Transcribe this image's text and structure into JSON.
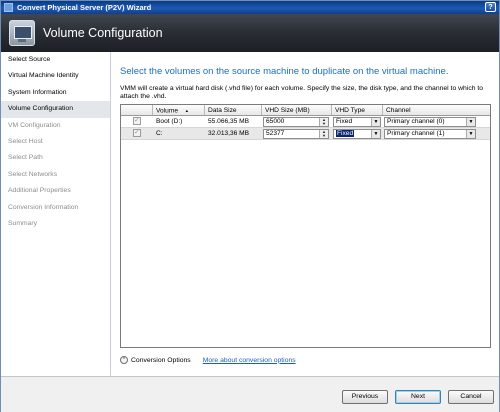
{
  "window": {
    "title": "Convert Physical Server (P2V) Wizard",
    "help_label": "?"
  },
  "banner": {
    "title": "Volume Configuration"
  },
  "nav": {
    "items": [
      {
        "label": "Select Source",
        "state": "done"
      },
      {
        "label": "Virtual Machine Identity",
        "state": "done"
      },
      {
        "label": "System Information",
        "state": "done"
      },
      {
        "label": "Volume Configuration",
        "state": "selected"
      },
      {
        "label": "VM Configuration",
        "state": "dim"
      },
      {
        "label": "Select Host",
        "state": "dim"
      },
      {
        "label": "Select Path",
        "state": "dim"
      },
      {
        "label": "Select Networks",
        "state": "dim"
      },
      {
        "label": "Additional Properties",
        "state": "dim"
      },
      {
        "label": "Conversion Information",
        "state": "dim"
      },
      {
        "label": "Summary",
        "state": "dim"
      }
    ]
  },
  "main": {
    "heading": "Select the volumes on the source machine to duplicate on the virtual machine.",
    "description": "VMM will create a virtual hard disk (.vhd file) for each volume. Specify the size, the disk type, and the channel to which to attach the .vhd."
  },
  "grid": {
    "columns": [
      "",
      "Volume",
      "Data Size",
      "VHD Size (MB)",
      "VHD Type",
      "Channel"
    ],
    "sort_indicator": "▲",
    "rows": [
      {
        "checked": true,
        "volume": "Boot (D:)",
        "data_size": "55.066,35 MB",
        "vhd_size": "65000",
        "vhd_type": "Fixed",
        "channel": "Primary channel (0)"
      },
      {
        "checked": true,
        "volume": "C:",
        "data_size": "32.013,36 MB",
        "vhd_size": "52377",
        "vhd_type": "Fixed",
        "channel": "Primary channel (1)"
      }
    ]
  },
  "options": {
    "toggle_label": "Conversion Options",
    "more_link": "More about conversion options",
    "toggle_glyph": "⌃"
  },
  "footer": {
    "previous": "Previous",
    "next": "Next",
    "cancel": "Cancel"
  }
}
